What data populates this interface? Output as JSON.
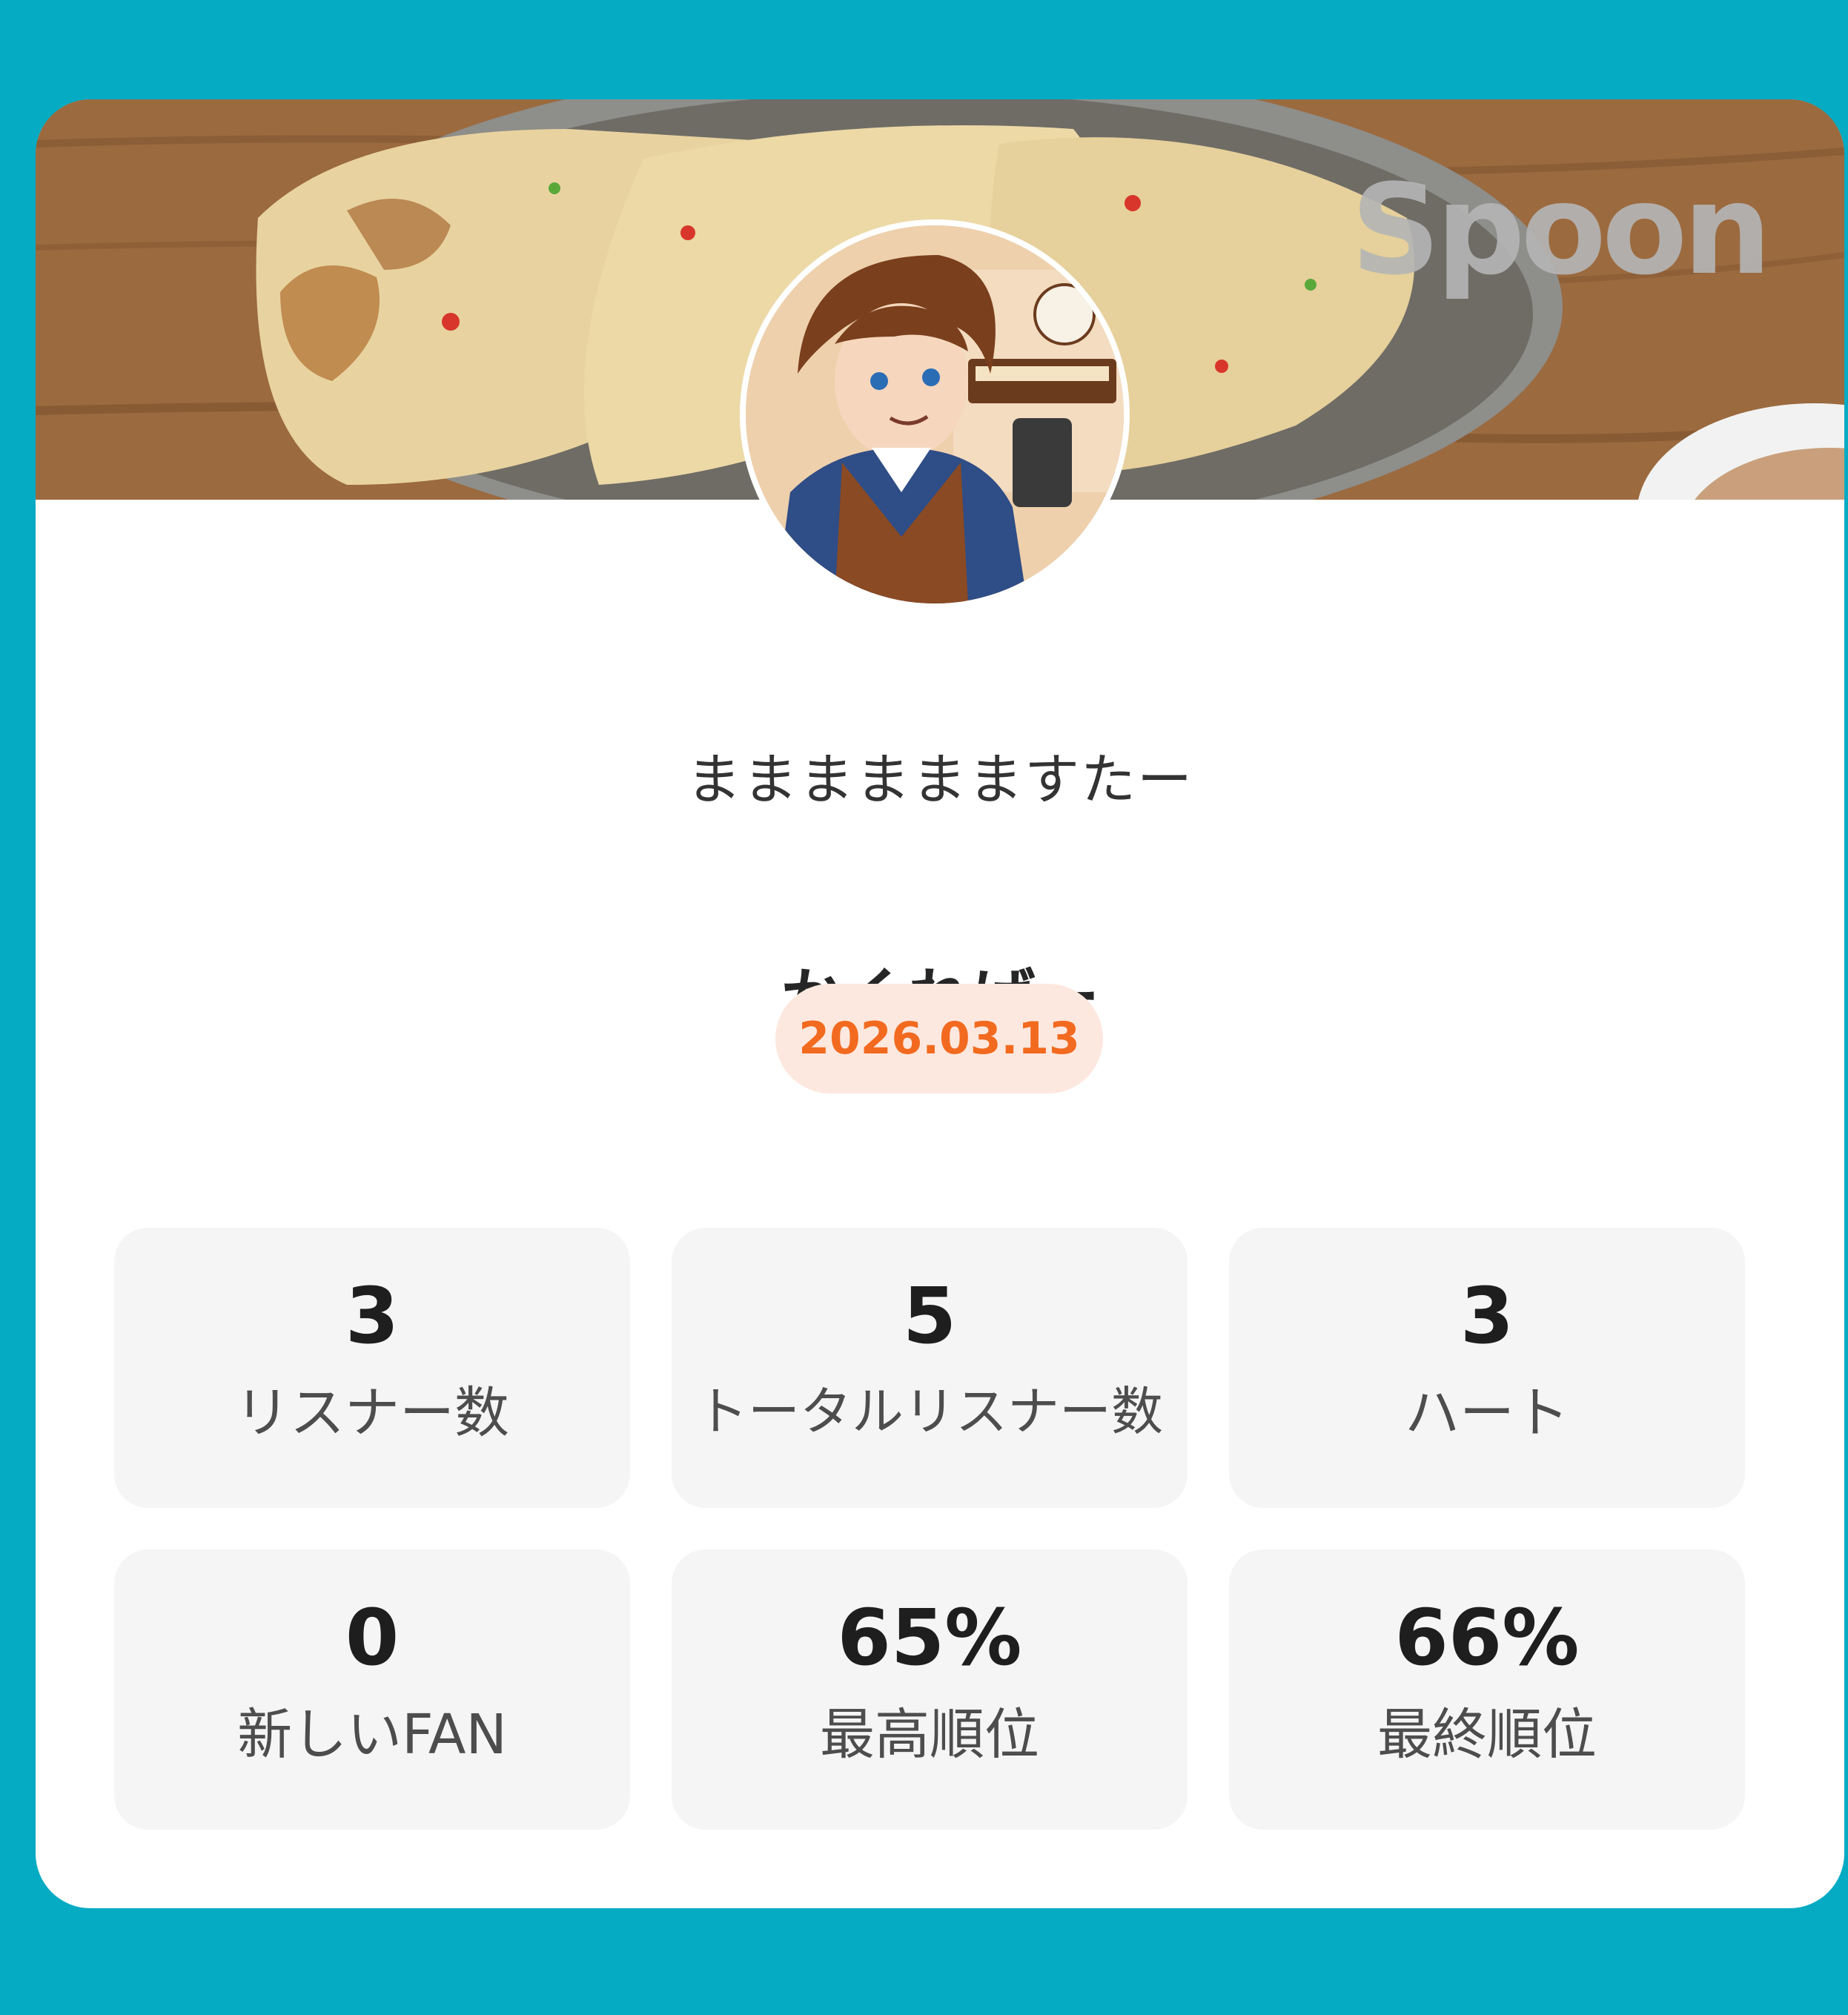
{
  "brand": {
    "logo_text": "Spoon"
  },
  "profile": {
    "username": "まままままますたー"
  },
  "stream": {
    "title": "かくればー",
    "date": "2026.03.13"
  },
  "stats": [
    {
      "value": "3",
      "label": "リスナー数"
    },
    {
      "value": "5",
      "label": "トータルリスナー数"
    },
    {
      "value": "3",
      "label": "ハート"
    },
    {
      "value": "0",
      "label": "新しいFAN"
    },
    {
      "value": "65%",
      "label": "最高順位"
    },
    {
      "value": "66%",
      "label": "最終順位"
    }
  ],
  "colors": {
    "background": "#04abc3",
    "card": "#ffffff",
    "date_text": "#f26a1f",
    "date_badge": "#fde8df",
    "stat_tile": "#f5f5f5"
  },
  "icons": {
    "avatar": "character-avatar-image",
    "banner": "food-banner-image"
  }
}
